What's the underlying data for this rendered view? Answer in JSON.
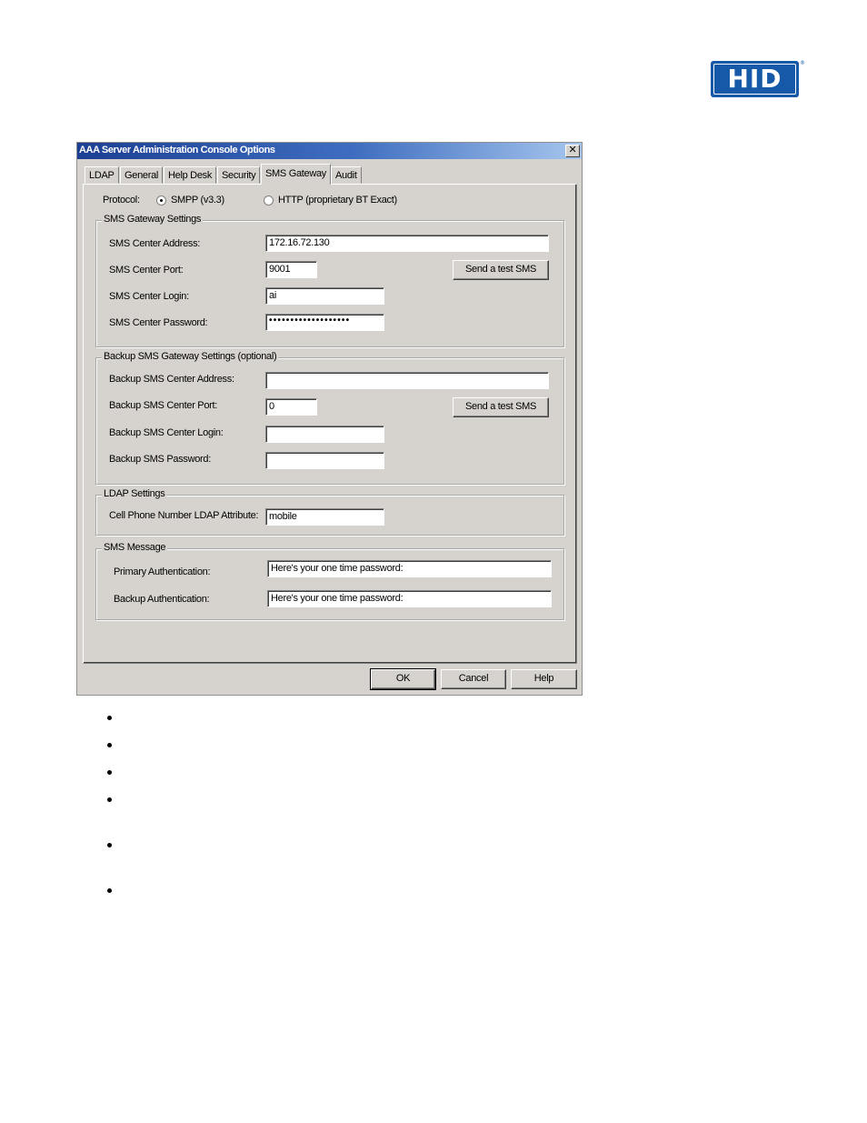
{
  "logo": {
    "text": "HID",
    "reg": "®"
  },
  "window": {
    "title": "AAA Server Administration Console Options",
    "close_glyph": "✕"
  },
  "tabs": [
    {
      "label": "LDAP"
    },
    {
      "label": "General"
    },
    {
      "label": "Help Desk"
    },
    {
      "label": "Security"
    },
    {
      "label": "SMS Gateway"
    },
    {
      "label": "Audit"
    }
  ],
  "active_tab": "SMS Gateway",
  "protocol": {
    "label": "Protocol:",
    "options": [
      {
        "label": "SMPP (v3.3)",
        "selected": true
      },
      {
        "label": "HTTP (proprietary BT Exact)",
        "selected": false
      }
    ]
  },
  "sms_gateway": {
    "title": "SMS Gateway Settings",
    "address_label": "SMS Center Address:",
    "address_value": "172.16.72.130",
    "port_label": "SMS Center Port:",
    "port_value": "9001",
    "login_label": "SMS Center Login:",
    "login_value": "ai",
    "password_label": "SMS Center Password:",
    "password_value": "•••••••••••••••••••",
    "test_button": "Send a test SMS"
  },
  "backup_gateway": {
    "title": "Backup SMS Gateway Settings (optional)",
    "address_label": "Backup SMS Center Address:",
    "address_value": "",
    "port_label": "Backup SMS Center Port:",
    "port_value": "0",
    "login_label": "Backup SMS Center Login:",
    "login_value": "",
    "password_label": "Backup SMS Password:",
    "password_value": "",
    "test_button": "Send a test SMS"
  },
  "ldap_settings": {
    "title": "LDAP Settings",
    "phone_attr_label": "Cell Phone Number LDAP Attribute:",
    "phone_attr_value": "mobile"
  },
  "sms_message": {
    "title": "SMS Message",
    "primary_label": "Primary Authentication:",
    "primary_value": "Here's your one time password:",
    "backup_label": "Backup Authentication:",
    "backup_value": "Here's your one time password:"
  },
  "footer": {
    "ok": "OK",
    "cancel": "Cancel",
    "help": "Help"
  },
  "bullet_count": 6
}
